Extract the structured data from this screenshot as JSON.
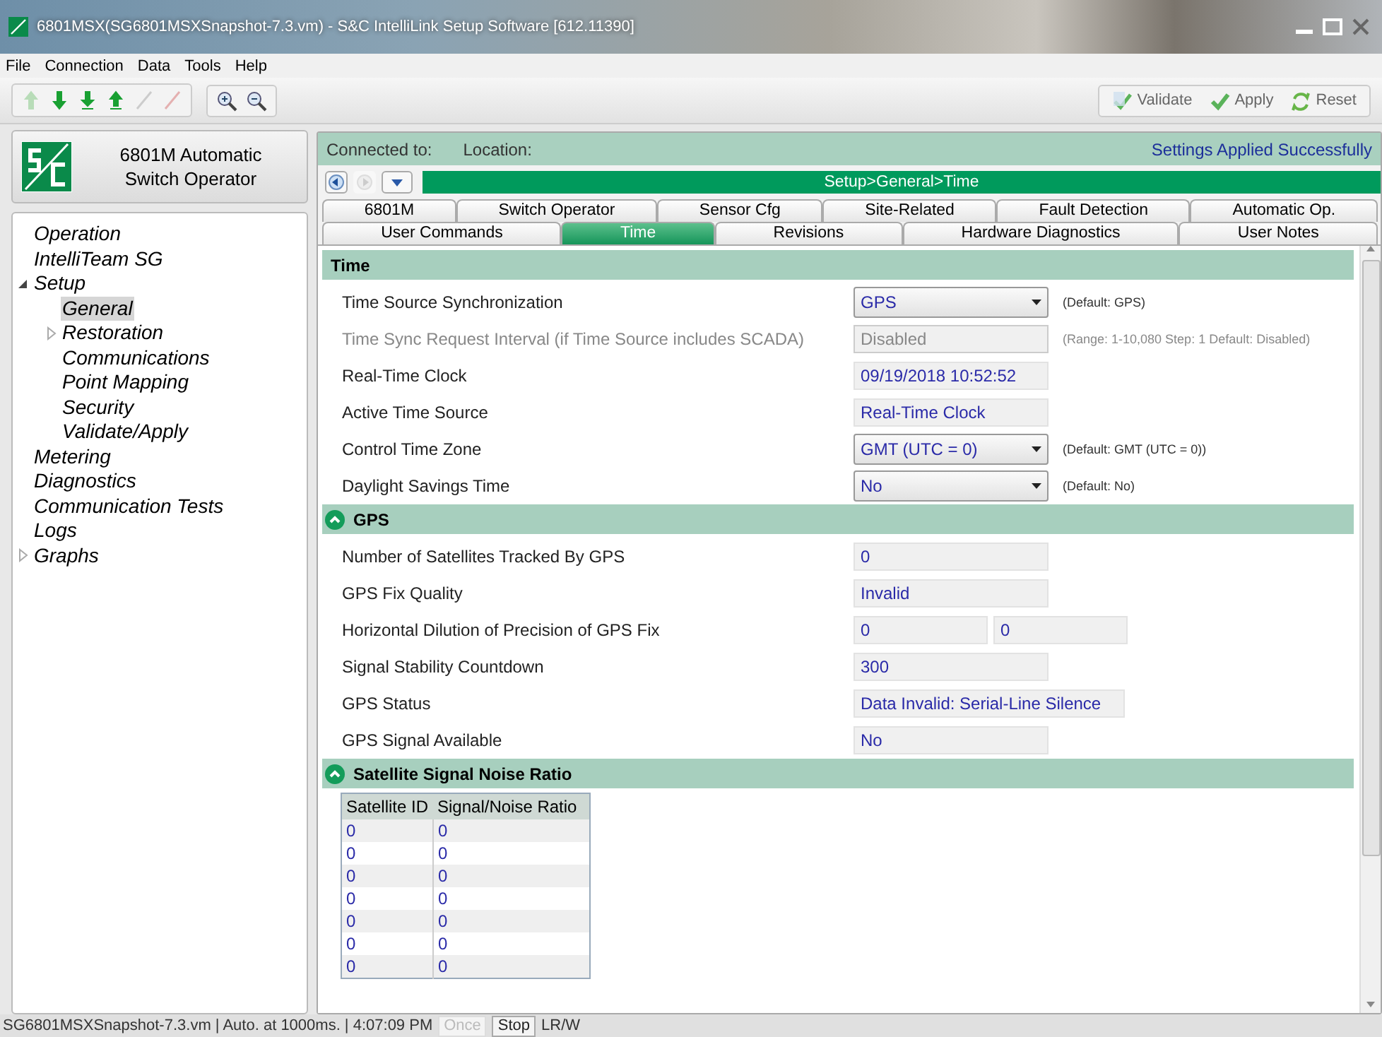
{
  "window": {
    "title": "6801MSX(SG6801MSXSnapshot-7.3.vm) - S&C IntelliLink Setup Software [612.11390]"
  },
  "menu": [
    "File",
    "Connection",
    "Data",
    "Tools",
    "Help"
  ],
  "actions": [
    "Validate",
    "Apply",
    "Reset"
  ],
  "device": {
    "name": "6801M Automatic Switch Operator"
  },
  "connection": {
    "connected_label": "Connected to:",
    "location_label": "Location:",
    "status": "Settings Applied Successfully"
  },
  "breadcrumb": "Setup>General>Time",
  "tree": [
    {
      "label": "Operation",
      "selected": false
    },
    {
      "label": "IntelliTeam SG",
      "selected": false
    },
    {
      "label": "Setup",
      "selected": false,
      "expanded": true,
      "children": [
        {
          "label": "General",
          "selected": true
        },
        {
          "label": "Restoration",
          "selected": false,
          "expanded": false
        },
        {
          "label": "Communications",
          "selected": false
        },
        {
          "label": "Point Mapping",
          "selected": false
        },
        {
          "label": "Security",
          "selected": false
        },
        {
          "label": "Validate/Apply",
          "selected": false
        }
      ]
    },
    {
      "label": "Metering",
      "selected": false
    },
    {
      "label": "Diagnostics",
      "selected": false
    },
    {
      "label": "Communication Tests",
      "selected": false
    },
    {
      "label": "Logs",
      "selected": false
    },
    {
      "label": "Graphs",
      "selected": false,
      "expanded": false
    }
  ],
  "tab_rows": [
    [
      {
        "label": "6801M",
        "selected": false
      },
      {
        "label": "Switch Operator",
        "selected": false
      },
      {
        "label": "Sensor Cfg",
        "selected": false
      },
      {
        "label": "Site-Related",
        "selected": false
      },
      {
        "label": "Fault Detection",
        "selected": false
      },
      {
        "label": "Automatic Op.",
        "selected": false
      }
    ],
    [
      {
        "label": "User Commands",
        "selected": false
      },
      {
        "label": "Time",
        "selected": true
      },
      {
        "label": "Revisions",
        "selected": false
      },
      {
        "label": "Hardware Diagnostics",
        "selected": false
      },
      {
        "label": "User Notes",
        "selected": false
      }
    ]
  ],
  "sections": [
    {
      "title": "Time",
      "collapsible": false,
      "rows": [
        {
          "kind": "dropdown",
          "label": "Time Source Synchronization",
          "value": "GPS",
          "note": "(Default: GPS)",
          "disabled": false
        },
        {
          "kind": "field",
          "label": "Time Sync Request Interval (if Time Source includes SCADA)",
          "value": "Disabled",
          "note": "(Range: 1-10,080 Step: 1 Default: Disabled)",
          "disabled": true
        },
        {
          "kind": "field",
          "label": "Real-Time Clock",
          "value": "09/19/2018 10:52:52",
          "disabled": false
        },
        {
          "kind": "field",
          "label": "Active Time Source",
          "value": "Real-Time Clock",
          "disabled": false
        },
        {
          "kind": "dropdown",
          "label": "Control Time Zone",
          "value": "GMT (UTC = 0)",
          "note": "(Default: GMT (UTC = 0))",
          "disabled": false
        },
        {
          "kind": "dropdown",
          "label": "Daylight Savings Time",
          "value": "No",
          "note": "(Default: No)",
          "disabled": false
        }
      ]
    },
    {
      "title": "GPS",
      "collapsible": true,
      "expanded": true,
      "rows": [
        {
          "kind": "field",
          "label": "Number of Satellites Tracked By GPS",
          "value": "0",
          "disabled": false
        },
        {
          "kind": "field",
          "label": "GPS Fix Quality",
          "value": "Invalid",
          "disabled": false
        },
        {
          "kind": "pair",
          "label": "Horizontal Dilution of Precision of GPS Fix",
          "values": [
            "0",
            "0"
          ],
          "disabled": false
        },
        {
          "kind": "field",
          "label": "Signal Stability Countdown",
          "value": "300",
          "disabled": false
        },
        {
          "kind": "field",
          "label": "GPS Status",
          "value": "Data Invalid: Serial-Line Silence",
          "disabled": false
        },
        {
          "kind": "field",
          "label": "GPS Signal Available",
          "value": "No",
          "disabled": false
        }
      ]
    },
    {
      "title": "Satellite Signal Noise Ratio",
      "collapsible": true,
      "expanded": true,
      "table": {
        "columns": [
          "Satellite ID",
          "Signal/Noise Ratio"
        ],
        "rows": [
          [
            "0",
            "0"
          ],
          [
            "0",
            "0"
          ],
          [
            "0",
            "0"
          ],
          [
            "0",
            "0"
          ],
          [
            "0",
            "0"
          ],
          [
            "0",
            "0"
          ],
          [
            "0",
            "0"
          ]
        ]
      }
    }
  ],
  "status_bar": {
    "text": "SG6801MSXSnapshot-7.3.vm | Auto. at 1000ms. | 4:07:09 PM",
    "buttons": [
      {
        "label": "Once",
        "disabled": true
      },
      {
        "label": "Stop",
        "disabled": false
      }
    ],
    "mode": "LR/W"
  }
}
